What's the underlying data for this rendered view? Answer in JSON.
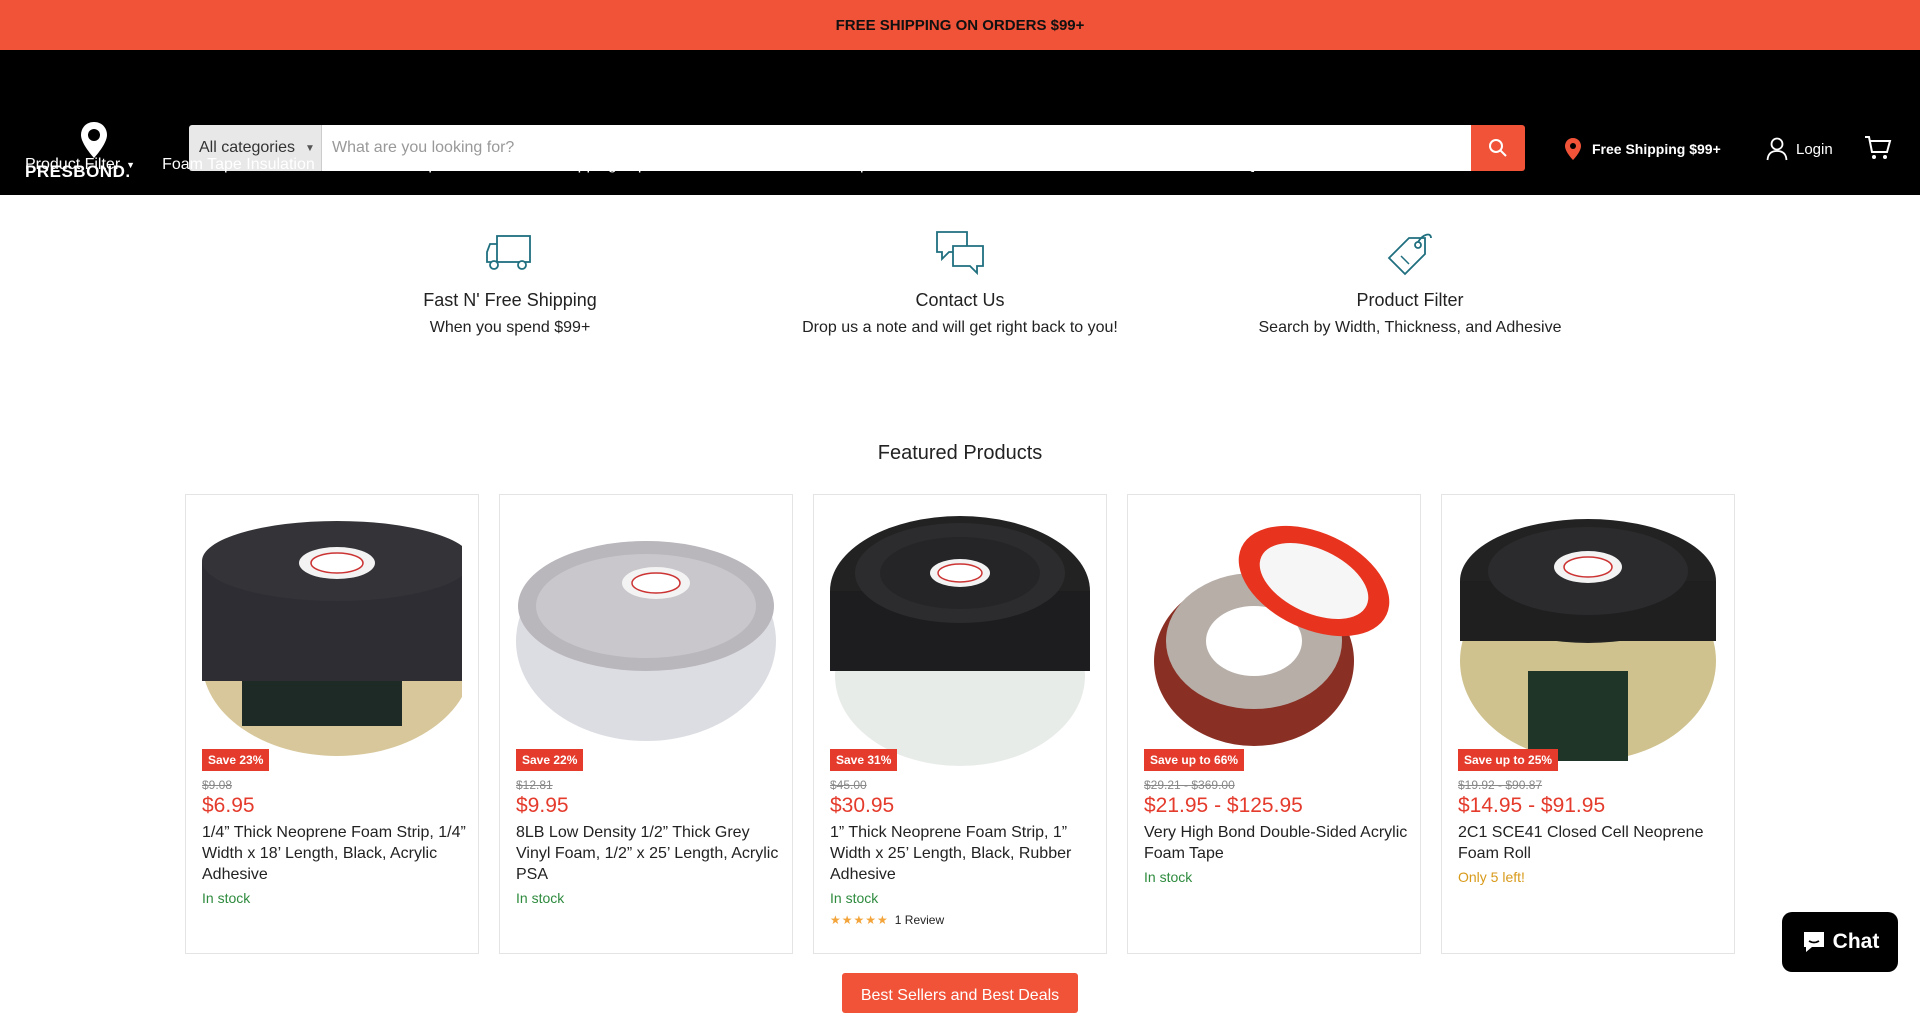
{
  "announcement": "FREE SHIPPING ON ORDERS $99+",
  "header": {
    "logo_text": "PRESBOND.",
    "search": {
      "category": "All categories",
      "placeholder": "What are you looking for?"
    },
    "shipping_link": "Free Shipping $99+",
    "login": "Login"
  },
  "nav": [
    {
      "label": "Product Filter"
    },
    {
      "label": "Foam Tape Insulation"
    },
    {
      "label": "Gasket Tapes"
    },
    {
      "label": "Weatherstripping Tape"
    },
    {
      "label": "Double Sided Foam Tape"
    },
    {
      "label": "Markets & Materials"
    },
    {
      "label": "Contact Us"
    },
    {
      "label": "FAQ"
    }
  ],
  "features": [
    {
      "icon": "truck-icon",
      "title": "Fast N' Free Shipping",
      "subtitle": "When you spend $99+"
    },
    {
      "icon": "chat-bubbles-icon",
      "title": "Contact Us",
      "subtitle": "Drop us a note and will get right back to you!"
    },
    {
      "icon": "tag-icon",
      "title": "Product Filter",
      "subtitle": "Search by Width, Thickness, and Adhesive"
    }
  ],
  "featured_title": "Featured Products",
  "products": [
    {
      "badge": "Save 23%",
      "compare": "$9.08",
      "price": "$6.95",
      "title": "1/4” Thick Neoprene Foam Strip, 1/4” Width x 18’ Length, Black, Acrylic Adhesive",
      "stock": "In stock"
    },
    {
      "badge": "Save 22%",
      "compare": "$12.81",
      "price": "$9.95",
      "title": "8LB Low Density 1/2” Thick Grey Vinyl Foam, 1/2” x 25’ Length, Acrylic PSA",
      "stock": "In stock"
    },
    {
      "badge": "Save 31%",
      "compare": "$45.00",
      "price": "$30.95",
      "title": "1” Thick Neoprene Foam Strip, 1” Width x 25’ Length, Black, Rubber Adhesive",
      "stock": "In stock",
      "stars": "★★★★★",
      "reviews": "1 Review"
    },
    {
      "badge": "Save up to 66%",
      "compare": "$29.21 - $369.00",
      "price": "$21.95 - $125.95",
      "title": "Very High Bond Double-Sided Acrylic Foam Tape",
      "stock": "In stock"
    },
    {
      "badge": "Save up to 25%",
      "compare": "$19.92 - $90.87",
      "price": "$14.95 - $91.95",
      "title": "2C1 SCE41 Closed Cell Neoprene Foam Roll",
      "stock": "Only 5 left!"
    }
  ],
  "best_button": "Best Sellers and Best Deals",
  "chat_label": "Chat",
  "colors": {
    "accent": "#f05338",
    "sale": "#e43b2c",
    "in_stock": "#2e8b3e",
    "low_stock": "#d89a1a",
    "icon_teal": "#1f6f7f"
  }
}
